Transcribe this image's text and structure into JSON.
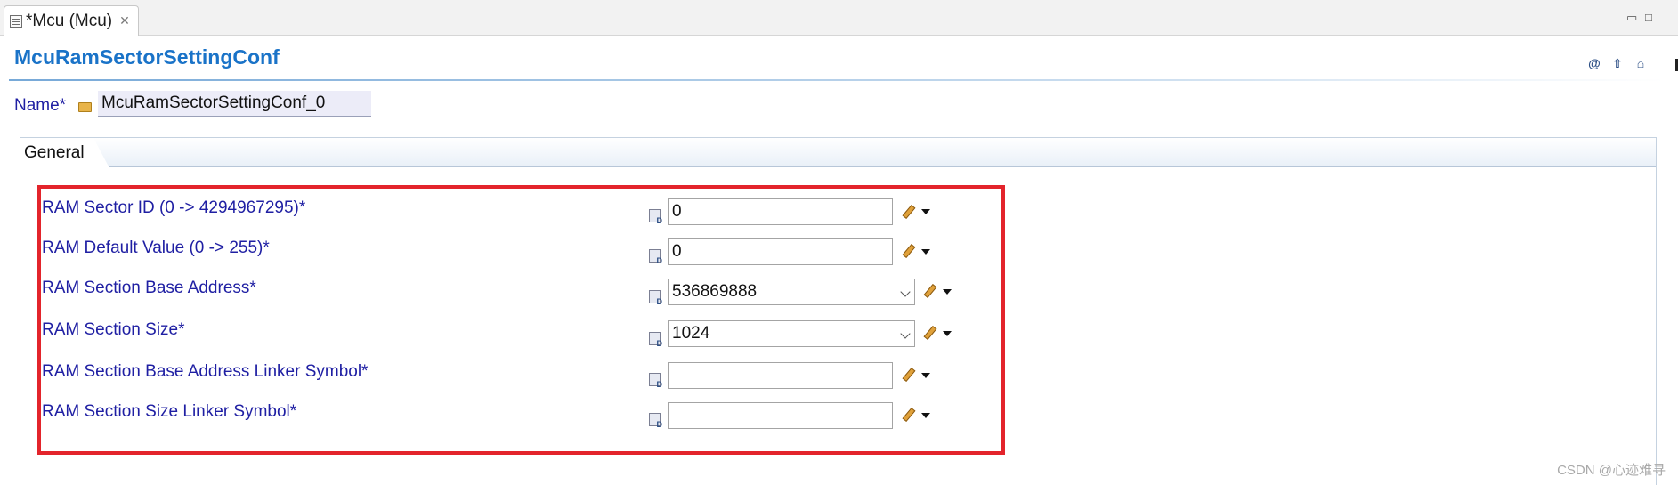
{
  "editor_tab": {
    "title": "*Mcu (Mcu)",
    "close": "✕"
  },
  "window_controls": {
    "minimize": "▭",
    "maximize": "□"
  },
  "form": {
    "title": "McuRamSectorSettingConf",
    "header_icons": [
      "@",
      "⇧",
      "⌂"
    ],
    "name_label": "Name*",
    "name_value": "McuRamSectorSettingConf_0"
  },
  "section_tab": "General",
  "fields": [
    {
      "label": "RAM Sector ID (0 -> 4294967295)*",
      "value": "0",
      "kind": "text"
    },
    {
      "label": "RAM Default Value (0 -> 255)*",
      "value": "0",
      "kind": "text"
    },
    {
      "label": "RAM Section Base Address*",
      "value": "536869888",
      "kind": "combo"
    },
    {
      "label": "RAM Section Size*",
      "value": "1024",
      "kind": "combo"
    },
    {
      "label": "RAM Section Base Address Linker Symbol*",
      "value": "",
      "kind": "text"
    },
    {
      "label": "RAM Section Size Linker Symbol*",
      "value": "",
      "kind": "text"
    }
  ],
  "watermark": "CSDN @心迹难寻",
  "colors": {
    "accent": "#1a73c8",
    "label": "#1f1fa3",
    "highlight": "#e3242b"
  }
}
